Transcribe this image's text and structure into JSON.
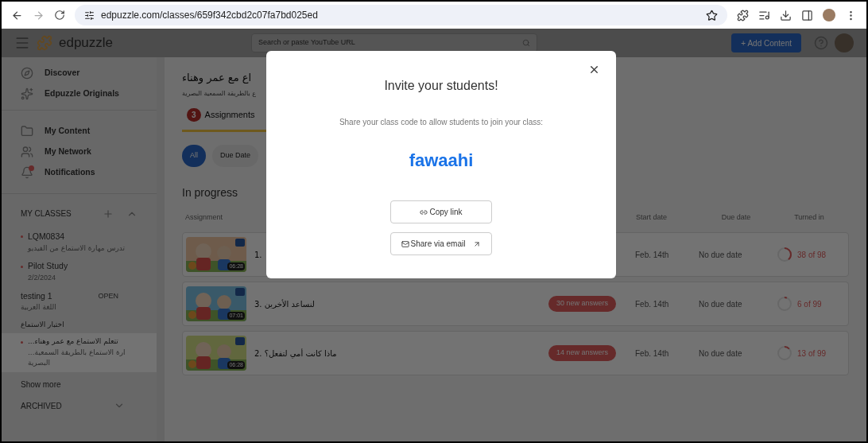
{
  "browser": {
    "url": "edpuzzle.com/classes/659f342cbd2c07fa7bd025ed"
  },
  "app_header": {
    "logo_text": "edpuzzle",
    "search": {
      "placeholder": "Search or paste YouTube URL"
    },
    "add_button": "+ Add Content"
  },
  "sidebar": {
    "nav_groups": [
      [
        {
          "label": "Discover"
        },
        {
          "label": "Edpuzzle Originals"
        }
      ],
      [
        {
          "label": "My Content"
        },
        {
          "label": "My Network"
        },
        {
          "label": "Notifications"
        }
      ]
    ],
    "classes_title": "MY CLASSES",
    "classes": [
      {
        "name": "LQM0834",
        "subtitle": "تدرس مهارة الاستماع من الفيديو",
        "dot": true,
        "selected": false
      },
      {
        "name": "Pilot Study",
        "subtitle": "2/2/2024",
        "dot": true,
        "selected": false
      },
      {
        "name": "testing 1",
        "subtitle": "اللغة العربية",
        "tag": "OPEN",
        "dot": false,
        "selected": false
      },
      {
        "name": "اختبار الاستماع",
        "dot": false,
        "selected": false
      },
      {
        "name": "...تتعلم الاستماع مع عمر وهناء",
        "subtitle": "...ارة الاستماع بالطريقة السمعية البصرية",
        "dot": true,
        "selected": true
      }
    ],
    "show_more": "Show more",
    "archived": "ARCHIVED"
  },
  "class_header": {
    "title": "اع مع عمر وهناء",
    "subtitle": "ع بالطريقة السمعية البصرية"
  },
  "tabs": [
    {
      "label": "Assignments",
      "count": "3",
      "selected": true
    }
  ],
  "filters": [
    {
      "label": "All",
      "selected": true
    },
    {
      "label": "Due Date",
      "selected": false
    }
  ],
  "section_title": "In progress",
  "table": {
    "columns": [
      "Assignment",
      "Start date",
      "Due date",
      "Turned in"
    ],
    "rows": [
      {
        "title": "1.",
        "duration": "06:28",
        "start": "Feb. 14th",
        "due": "No due date",
        "turned_in": "38 of 98",
        "level": 0.39
      },
      {
        "title": "3. لنساعد الأخرين",
        "duration": "07:01",
        "badge": "30 new answers",
        "start": "Feb. 14th",
        "due": "No due date",
        "turned_in": "6 of 99",
        "level": 0.06
      },
      {
        "title": "2. ماذا كانت أمي لتفعل؟",
        "duration": "06:28",
        "badge": "14 new answers",
        "start": "Feb. 14th",
        "due": "No due date",
        "turned_in": "13 of 99",
        "level": 0.13
      }
    ]
  },
  "modal": {
    "title": "Invite your students!",
    "description": "Share your class code to allow students to join your class:",
    "code": "fawaahi",
    "buttons": [
      "Copy link",
      "Share via email"
    ]
  }
}
